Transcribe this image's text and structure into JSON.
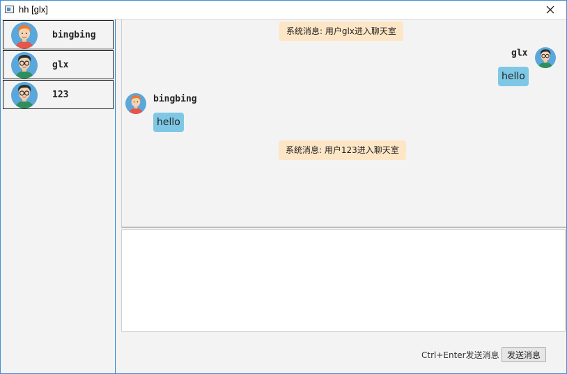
{
  "window": {
    "title": "hh [glx]"
  },
  "users": [
    {
      "name": "bingbing",
      "avatar": "orange-haired-boy-avatar"
    },
    {
      "name": "glx",
      "avatar": "glasses-boy-avatar"
    },
    {
      "name": "123",
      "avatar": "glasses-boy-avatar"
    }
  ],
  "chat": {
    "system_messages": [
      "系统消息: 用户glx进入聊天室",
      "系统消息: 用户123进入聊天室"
    ],
    "messages": [
      {
        "sender": "glx",
        "text": "hello",
        "side": "right"
      },
      {
        "sender": "bingbing",
        "text": "hello",
        "side": "left"
      }
    ]
  },
  "input": {
    "value": "",
    "placeholder": ""
  },
  "footer": {
    "hint": "Ctrl+Enter发送消息",
    "send_label": "发送消息"
  },
  "colors": {
    "accent": "#2a86c9",
    "bubble": "#7ec8e6",
    "system_bg": "#fde6c6"
  }
}
